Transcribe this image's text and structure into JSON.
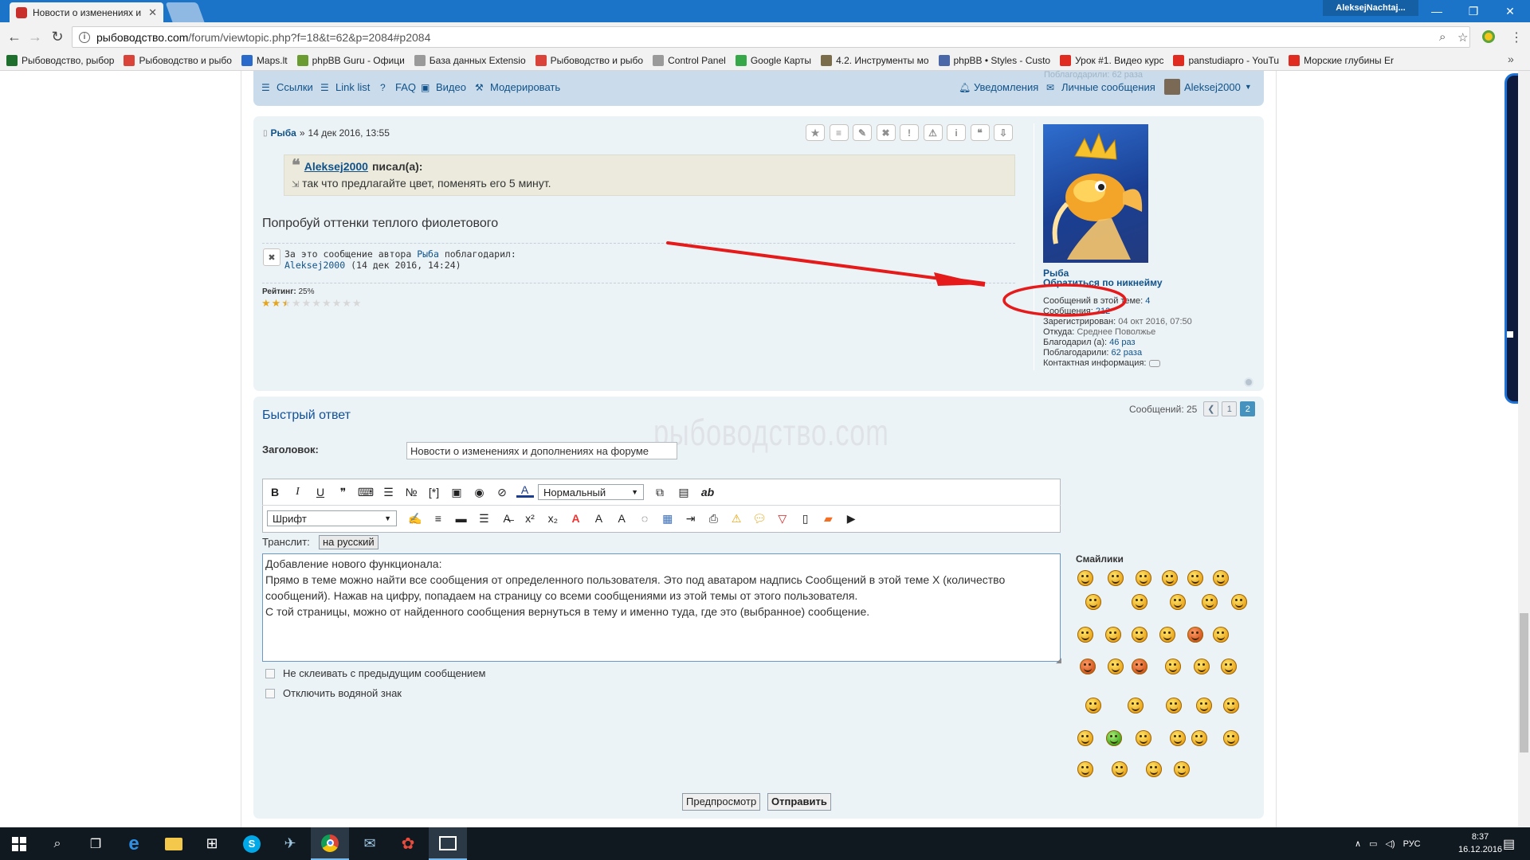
{
  "window": {
    "tab_title": "Новости о изменениях и",
    "user_label": "AleksejNachtaj..."
  },
  "address": {
    "url_domain": "рыбоводство.com",
    "url_path": "/forum/viewtopic.php?f=18&t=62&p=2084#p2084"
  },
  "bookmarks": [
    {
      "label": "Рыбоводство, рыбор",
      "color": "#1e6e2d"
    },
    {
      "label": "Рыбоводство и рыбо",
      "color": "#d9433a"
    },
    {
      "label": "Maps.lt",
      "color": "#2a6acb"
    },
    {
      "label": "phpBB Guru - Офици",
      "color": "#6a9c31"
    },
    {
      "label": "База данных Extensio",
      "color": "#9a9a9a"
    },
    {
      "label": "Рыбоводство и рыбо",
      "color": "#d9433a"
    },
    {
      "label": "Control Panel",
      "color": "#9a9a9a"
    },
    {
      "label": "Google Карты",
      "color": "#37a84a"
    },
    {
      "label": "4.2. Инструменты мо",
      "color": "#7b6d4b"
    },
    {
      "label": "phpBB • Styles - Custo",
      "color": "#4a67a8"
    },
    {
      "label": "Урок #1. Видео курс",
      "color": "#e02b20"
    },
    {
      "label": "panstudiapro - YouTu",
      "color": "#e02b20"
    },
    {
      "label": "Морские глубины Er",
      "color": "#e02b20"
    }
  ],
  "navbar": {
    "ghost_text": "Поблагодарили: 62 раза",
    "links": "Ссылки",
    "link_list": "Link list",
    "faq": "FAQ",
    "video": "Видео",
    "moderate": "Модерировать",
    "notifications": "Уведомления",
    "messages": "Личные сообщения",
    "username": "Aleksej2000"
  },
  "post": {
    "author": "Рыба",
    "separator": "»",
    "date": "14 дек 2016, 13:55",
    "quote_author": "Aleksej2000",
    "quote_wrote": "писал(а):",
    "quote_text": "так что предлагайте цвет, поменять его 5 минут.",
    "text": "Попробуй оттенки теплого фиолетового",
    "thanks_line1_prefix": "За это сообщение автора",
    "thanks_line1_author": "Рыба",
    "thanks_line1_suffix": "поблагодарил:",
    "thanks_line2_user": "Aleksej2000",
    "thanks_line2_date": "(14 дек 2016, 14:24)",
    "rating_label": "Рейтинг:",
    "rating_value": "25%",
    "rating_fraction": 0.25,
    "stars_total": 10,
    "stars_filled": 2.5
  },
  "profile": {
    "name": "Рыба",
    "rank": "Обратиться по никнейму",
    "topic_posts_label": "Сообщений в этой теме:",
    "topic_posts_value": "4",
    "posts_label": "Сообщения:",
    "posts_value": "212",
    "registered_label": "Зарегистрирован:",
    "registered_value": "04 окт 2016, 07:50",
    "from_label": "Откуда:",
    "from_value": "Среднее Поволжье",
    "thanked_label": "Благодарил (а):",
    "thanked_value": "46 раз",
    "got_thanks_label": "Поблагодарили:",
    "got_thanks_value": "62 раза",
    "contact_label": "Контактная информация:"
  },
  "quick_reply": {
    "title": "Быстрый ответ",
    "posts_count": "Сообщений: 25",
    "page1": "1",
    "page2": "2",
    "watermark": "рыбоводство.com",
    "subject_label": "Заголовок:",
    "subject_value": "Новости о изменениях и дополнениях на форуме",
    "size_select": "Нормальный",
    "font_select": "Шрифт",
    "translit_label": "Транслит:",
    "translit_button": "на русский",
    "message_lines": [
      "Добавление нового функционала:",
      "Прямо в теме можно найти все сообщения от определенного пользователя. Это под аватаром надпись Сообщений в этой теме Х (количество",
      "сообщений). Нажав на цифру, попадаем на страницу со всеми сообщениями из этой темы от этого пользователя.",
      "С той страницы, можно от найденного сообщения вернуться в тему  и именно туда, где это (выбранное) сообщение."
    ],
    "no_merge_label": "Не склеивать с предыдущим сообщением",
    "no_watermark_label": "Отключить водяной знак",
    "preview_button": "Предпросмотр",
    "submit_button": "Отправить",
    "smilies_title": "Смайлики"
  },
  "taskbar": {
    "lang": "РУС",
    "time": "8:37",
    "date": "16.12.2016"
  },
  "colors": {
    "link": "#105289",
    "annotation": "#e51b1b",
    "panel_bg": "#ecf3f7"
  }
}
